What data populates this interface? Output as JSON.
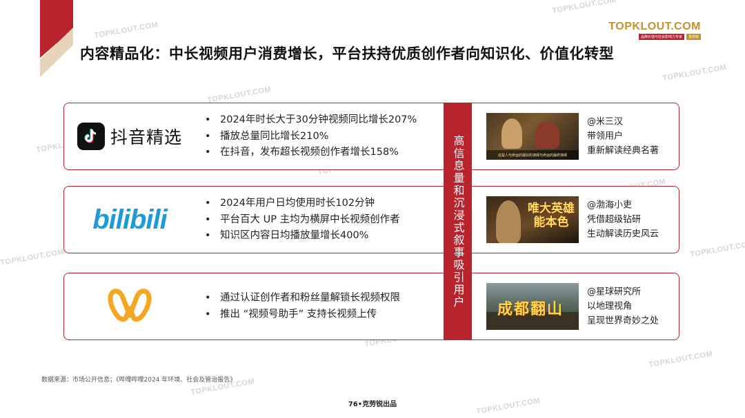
{
  "title": "内容精品化：中长视频用户消费增长，平台扶持优质创作者向知识化、价值化转型",
  "brand": {
    "name": "TOPKLOUT.COM",
    "tagline": "品牌价值与社会影响力专家",
    "cn": "克劳锐"
  },
  "watermark": "TOPKLOUT.COM",
  "center_label": "高信息量和沉浸式叙事吸引用户",
  "platforms": [
    {
      "logo_text": "抖音精选",
      "bullets": [
        "2024年时长大于30分钟视频同比增长207%",
        "播放总量同比增长210%",
        "在抖音，发布超长视频创作者增长158%"
      ],
      "thumb_caption": "这是人与命运的最好的演绎与命运的最终演绎",
      "desc": [
        "@米三汉",
        "带领用户",
        "重新解读经典名著"
      ]
    },
    {
      "logo_text": "bilibili",
      "bullets": [
        "2024年用户日均使用时长102分钟",
        "平台百大 UP 主均为横屏中长视频创作者",
        "知识区内容日均播放量增长400%"
      ],
      "thumb_title": "唯大英雄\n能本色",
      "desc": [
        "@渤海小吏",
        "凭借超级钻研",
        "生动解读历史风云"
      ]
    },
    {
      "logo_text": "",
      "bullets": [
        "通过认证创作者和粉丝量解锁长视频权限",
        "推出 “视频号助手” 支持长视频上传"
      ],
      "thumb_title": "成都翻山",
      "desc": [
        "@星球研究所",
        "以地理视角",
        "呈现世界奇妙之处"
      ]
    }
  ],
  "source": "数据来源：市场公开信息；《哔哩哔哩2024 年环境、社会及管治报告》",
  "page": "76•克劳锐出品",
  "colors": {
    "accent_red": "#b8232e",
    "gold": "#c4922d",
    "bili_blue": "#1e9bd7",
    "wechat_channels_orange": "#f5a623"
  }
}
